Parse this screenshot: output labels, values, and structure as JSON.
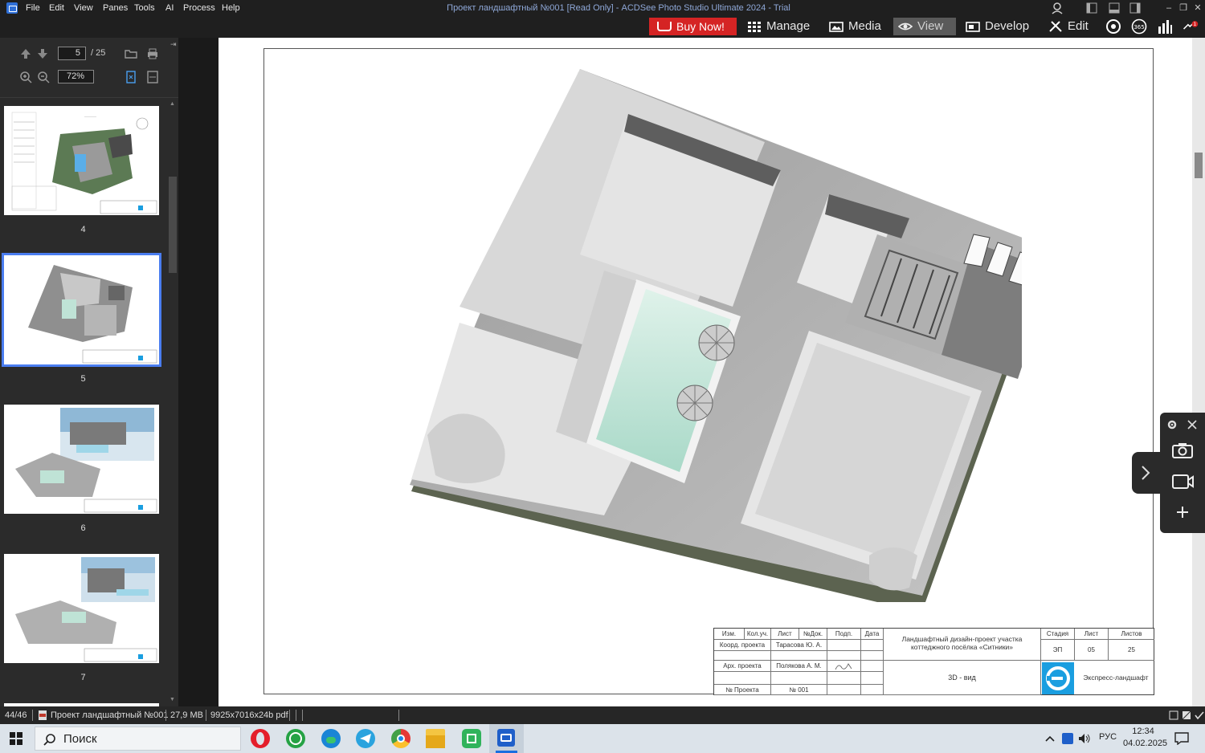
{
  "menu": {
    "items": [
      "File",
      "Edit",
      "View",
      "Panes",
      "Tools",
      "AI",
      "Process",
      "Help"
    ]
  },
  "window": {
    "title": "Проект ландшафтный №001 [Read Only] - ACDSee Photo Studio Ultimate 2024 - Trial"
  },
  "modes": {
    "buy_now": "Buy Now!",
    "manage": "Manage",
    "media": "Media",
    "view": "View",
    "develop": "Develop",
    "edit": "Edit"
  },
  "badges": {
    "notification_count": "1",
    "badge_365": "365"
  },
  "nav": {
    "current_page": "5",
    "total_pages": "/ 25",
    "zoom": "72%"
  },
  "thumbnails": [
    {
      "label": "4"
    },
    {
      "label": "5"
    },
    {
      "label": "6"
    },
    {
      "label": "7"
    }
  ],
  "titleblock": {
    "headers": [
      "Изм.",
      "Кол.уч.",
      "Лист",
      "№Док.",
      "Подп.",
      "Дата"
    ],
    "row1_role": "Коорд. проекта",
    "row1_name": "Тарасова Ю. А.",
    "row2_role": "Арх. проекта",
    "row2_name": "Полякова А. М.",
    "row3_role": "№ Проекта",
    "row3_name": "№ 001",
    "project_title": "Ландшафтный дизайн-проект участка коттеджного посёлка «Ситники»",
    "stage_header": "Стадия",
    "sheet_header": "Лист",
    "sheets_header": "Листов",
    "stage": "ЭП",
    "sheet": "05",
    "sheets": "25",
    "view_name": "3D - вид",
    "company": "Экспресс-ландшафт"
  },
  "statusbar": {
    "position": "44/46",
    "filename": "Проект ландшафтный №001",
    "filesize": "27,9 MB",
    "dimensions": "9925x7016x24b pdf"
  },
  "taskbar": {
    "search_placeholder": "Поиск",
    "language": "РУС",
    "time": "12:34",
    "date": "04.02.2025"
  },
  "colors": {
    "buy_now": "#d52424",
    "selection": "#4a7df0",
    "pool_water": "#bfe3d6",
    "brand_blue": "#1a9ee0"
  }
}
